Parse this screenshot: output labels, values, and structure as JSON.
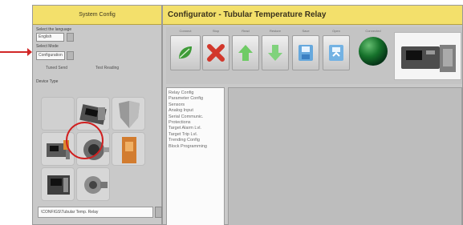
{
  "left_panel": {
    "title": "System Config",
    "language_label": "Select the language",
    "language_value": "English",
    "mode_label": "Select Mode",
    "mode_value": "Configuration",
    "radios": [
      "Tuned Send",
      "Test Reading"
    ],
    "device_type_label": "Device Type",
    "file_path": "\\CONFIGS\\Tubular Temp. Relay"
  },
  "window": {
    "title": "Configurator -  Tubular Temperature Relay"
  },
  "toolbar": {
    "labels": [
      "Connect",
      "Stop",
      "Read",
      "Restore",
      "Save",
      "Open",
      "Connected",
      ""
    ]
  },
  "menu": {
    "items": [
      "Relay Config",
      "Parameter Config",
      "Sensors",
      "Analog Input",
      "Serial Communic.",
      "Protections",
      "Target Alarm Lvl.",
      "Target Trip Lvl.",
      "Trending Config",
      "Block Programming"
    ]
  },
  "colors": {
    "header_yellow": "#f3e06b",
    "panel_gray": "#c9c9c9",
    "highlight_red": "#d02020",
    "status_green": "#16722b"
  }
}
